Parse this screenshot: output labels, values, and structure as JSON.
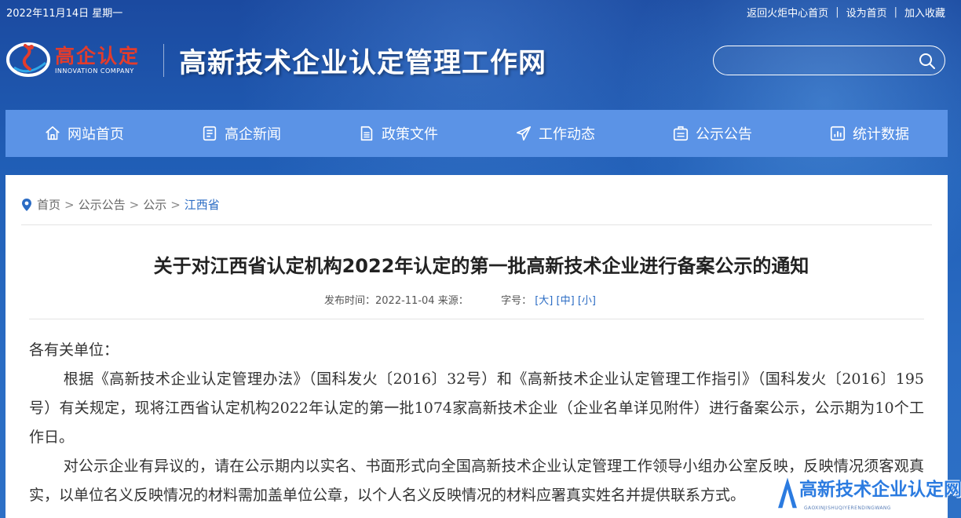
{
  "topbar": {
    "date": "2022年11月14日 星期一",
    "links": [
      "返回火炬中心首页",
      "设为首页",
      "加入收藏"
    ],
    "separator": "|"
  },
  "logo": {
    "cn": "高企认定",
    "en": "INNOVATION COMPANY"
  },
  "site_title": "高新技术企业认定管理工作网",
  "search": {
    "placeholder": "",
    "value": "",
    "icon": "search-icon"
  },
  "nav": {
    "items": [
      {
        "label": "网站首页",
        "icon": "home-icon"
      },
      {
        "label": "高企新闻",
        "icon": "news-icon"
      },
      {
        "label": "政策文件",
        "icon": "document-icon"
      },
      {
        "label": "工作动态",
        "icon": "send-icon"
      },
      {
        "label": "公示公告",
        "icon": "notice-icon"
      },
      {
        "label": "统计数据",
        "icon": "chart-icon"
      }
    ]
  },
  "breadcrumb": {
    "items": [
      "首页",
      "公示公告",
      "公示"
    ],
    "current": "江西省",
    "separator": ">"
  },
  "article": {
    "title": "关于对江西省认定机构2022年认定的第一批高新技术企业进行备案公示的通知",
    "meta": {
      "publish_label": "发布时间：",
      "publish_date": "2022-11-04",
      "source_label": "来源：",
      "font_label": "字号：",
      "font_large": "[大]",
      "font_medium": "[中]",
      "font_small": "[小]"
    },
    "paragraphs": [
      "各有关单位：",
      "根据《高新技术企业认定管理办法》（国科发火〔2016〕32号）和《高新技术企业认定管理工作指引》（国科发火〔2016〕195号）有关规定，现将江西省认定机构2022年认定的第一批1074家高新技术企业（企业名单详见附件）进行备案公示，公示期为10个工作日。",
      "对公示企业有异议的，请在公示期内以实名、书面形式向全国高新技术企业认定管理工作领导小组办公室反映，反映情况须客观真实，以单位名义反映情况的材料需加盖单位公章，以个人名义反映情况的材料应署真实姓名并提供联系方式。"
    ]
  },
  "watermark": {
    "text": "高新技术企业认定网",
    "sub": "GAOXINJISHUQIYERENDINGWANG"
  },
  "colors": {
    "banner": "#2160b8",
    "nav": "#5b93e6",
    "accent": "#2b6cc4",
    "logo_red": "#e23c2c"
  }
}
